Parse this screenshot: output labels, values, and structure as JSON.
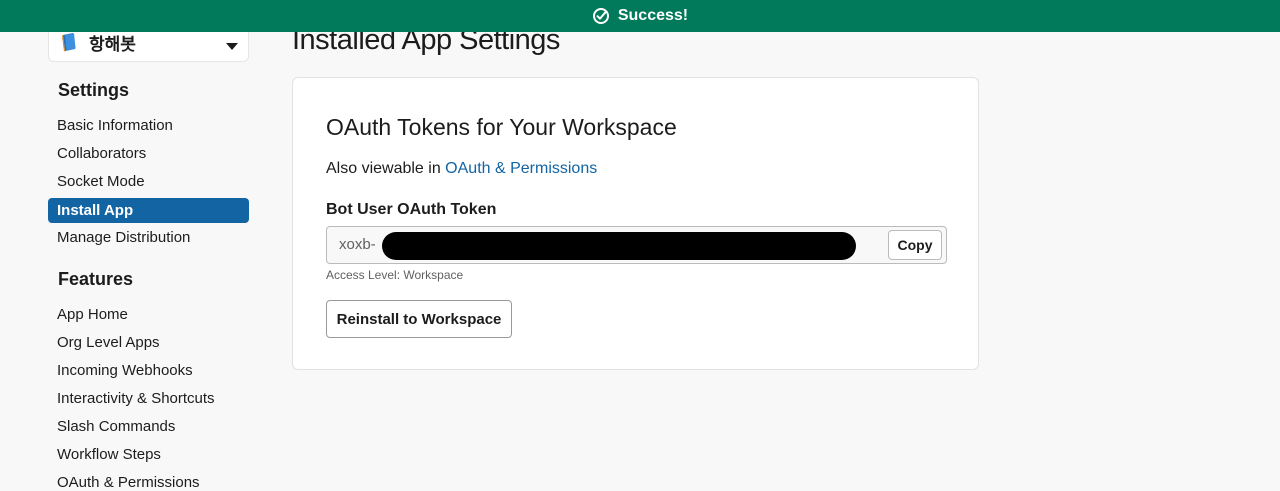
{
  "banner": {
    "text": "Success!",
    "icon": "check-circle-icon",
    "color": "#007a5a"
  },
  "sidebar": {
    "app_name": "항해봇",
    "app_icon": "book-icon",
    "settings_title": "Settings",
    "settings_items": [
      {
        "label": "Basic Information"
      },
      {
        "label": "Collaborators"
      },
      {
        "label": "Socket Mode"
      },
      {
        "label": "Install App",
        "active": true
      },
      {
        "label": "Manage Distribution"
      }
    ],
    "features_title": "Features",
    "features_items": [
      {
        "label": "App Home"
      },
      {
        "label": "Org Level Apps"
      },
      {
        "label": "Incoming Webhooks"
      },
      {
        "label": "Interactivity & Shortcuts"
      },
      {
        "label": "Slash Commands"
      },
      {
        "label": "Workflow Steps"
      },
      {
        "label": "OAuth & Permissions"
      }
    ]
  },
  "main": {
    "page_title": "Installed App Settings",
    "card": {
      "title": "OAuth Tokens for Your Workspace",
      "also_prefix": "Also viewable in ",
      "also_link": "OAuth & Permissions",
      "token_label": "Bot User OAuth Token",
      "token_prefix": "xoxb-",
      "copy_label": "Copy",
      "access_level": "Access Level: Workspace",
      "reinstall_label": "Reinstall to Workspace"
    }
  },
  "colors": {
    "accent": "#1264a3",
    "success": "#007a5a"
  }
}
